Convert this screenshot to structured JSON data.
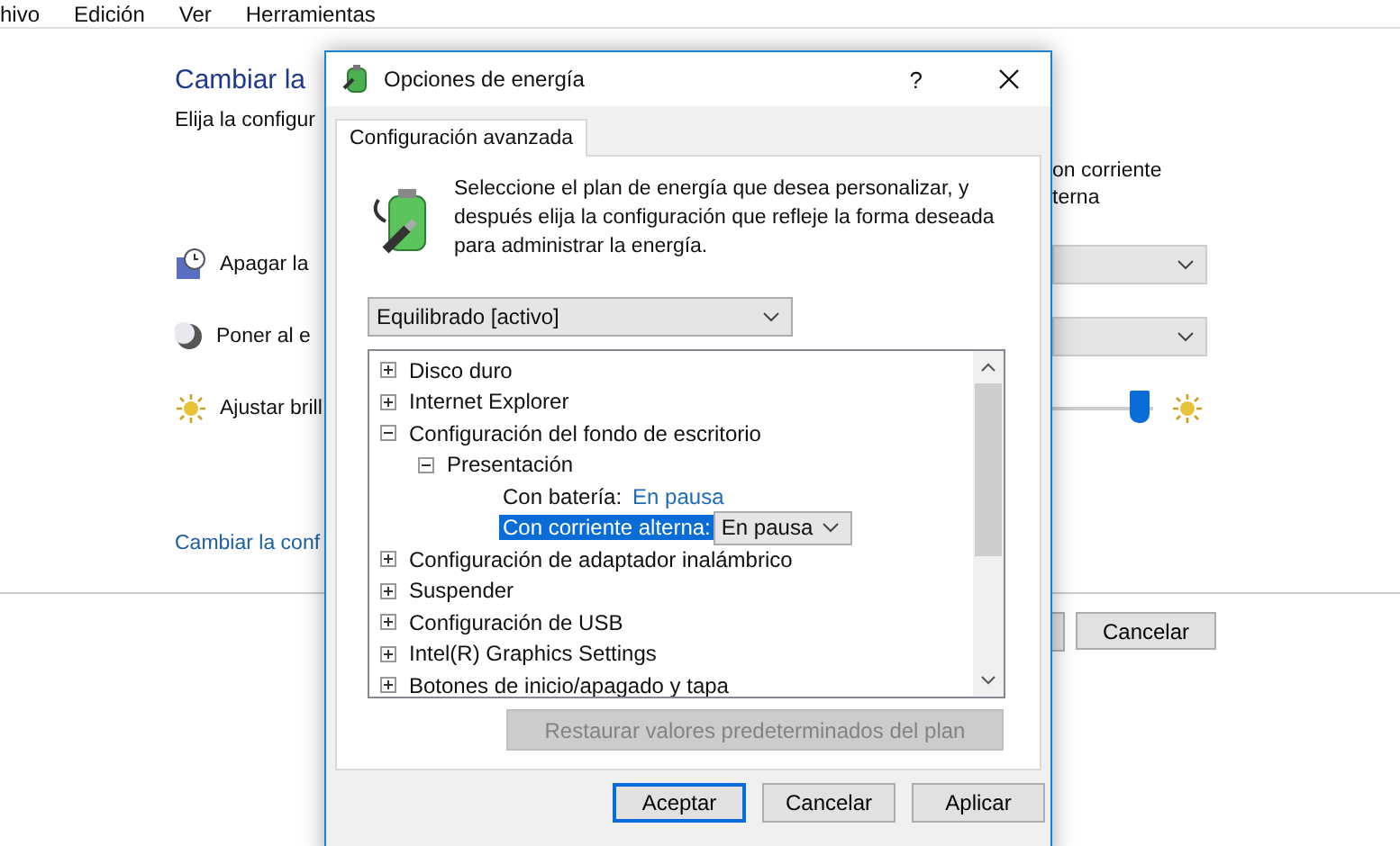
{
  "menu_bar": [
    "hivo",
    "Edición",
    "Ver",
    "Herramientas"
  ],
  "background": {
    "title": "Cambiar la",
    "subtitle": "Elija la configur",
    "column_header": [
      "on corriente",
      "terna"
    ],
    "settings": [
      {
        "kind": "dropdown",
        "label": "Apagar la"
      },
      {
        "kind": "dropdown",
        "label": "Poner al e"
      },
      {
        "kind": "slider",
        "label": "Ajustar brill",
        "level": 0.92
      }
    ],
    "link": "Cambiar la conf",
    "buttons": [
      "Cancelar"
    ]
  },
  "dialog": {
    "title": "Opciones de energía",
    "help": "?",
    "tabs": [
      {
        "label": "Configuración avanzada",
        "selected": true
      }
    ],
    "description": "Seleccione el plan de energía que desea personalizar, y después elija la configuración que refleje la forma deseada para administrar la energía.",
    "plan": "Equilibrado [activo]",
    "tree": [
      {
        "kind": "group",
        "label": "Disco duro",
        "expanded": false
      },
      {
        "kind": "group",
        "label": "Internet Explorer",
        "expanded": false
      },
      {
        "kind": "group",
        "label": "Configuración del fondo de escritorio",
        "expanded": true,
        "children": [
          {
            "kind": "group",
            "label": "Presentación",
            "expanded": true,
            "children": [
              {
                "kind": "setting",
                "label": "Con batería:",
                "value": "En pausa",
                "selected": false
              },
              {
                "kind": "setting",
                "label": "Con corriente alterna:",
                "value": "En pausa",
                "selected": true
              }
            ]
          }
        ]
      },
      {
        "kind": "group",
        "label": "Configuración de adaptador inalámbrico",
        "expanded": false
      },
      {
        "kind": "group",
        "label": "Suspender",
        "expanded": false
      },
      {
        "kind": "group",
        "label": "Configuración de USB",
        "expanded": false
      },
      {
        "kind": "group",
        "label": "Intel(R) Graphics Settings",
        "expanded": false
      },
      {
        "kind": "group",
        "label": "Botones de inicio/apagado y tapa",
        "expanded": false
      }
    ],
    "restore_button": {
      "label": "Restaurar valores predeterminados del plan",
      "disabled": true
    },
    "buttons": [
      {
        "label": "Aceptar",
        "default": true
      },
      {
        "label": "Cancelar",
        "default": false
      },
      {
        "label": "Aplicar",
        "default": false
      }
    ]
  }
}
